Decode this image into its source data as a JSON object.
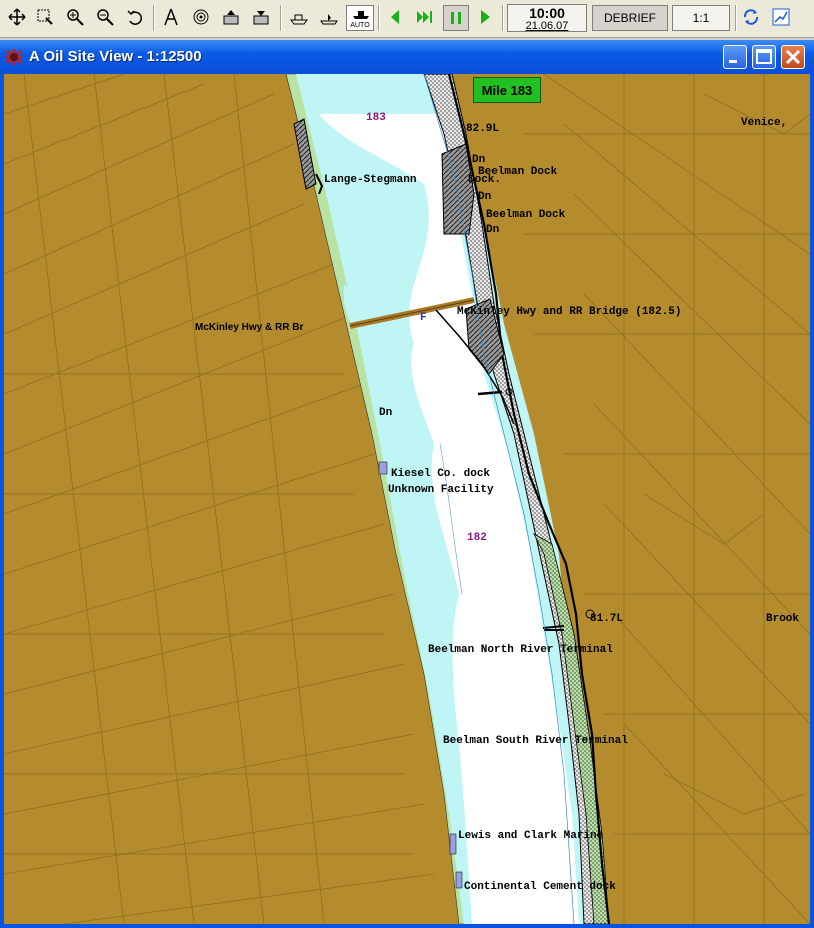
{
  "toolbar": {
    "auto_label": "AUTO",
    "time": "10:00",
    "date": "21.06.07",
    "debrief_label": "DEBRIEF",
    "scale_ratio": "1:1",
    "icons": [
      "pan-icon",
      "select-icon",
      "zoom-in-icon",
      "zoom-out-icon",
      "undo-icon",
      "compass-icon",
      "target-icon",
      "upload-icon",
      "download-icon",
      "boat-icon",
      "ship-icon",
      "auto-ship-icon",
      "step-back-icon",
      "fast-forward-icon",
      "pause-icon",
      "play-icon",
      "sync-icon",
      "chart-icon"
    ]
  },
  "window": {
    "title": "A Oil Site View - 1:12500",
    "title_color": "#0a5ae6"
  },
  "map": {
    "mile_marker": "Mile 183",
    "land_color": "#b48c2e",
    "water_color": "#bff5f5",
    "channel_color": "#ffffff",
    "bank_color": "#b9e3a4",
    "labels": {
      "venice": "Venice,",
      "brook": "Brook",
      "m183": "183",
      "m182": "182",
      "m1829": "82.9L",
      "m1817": "81.7L",
      "dn1": "Dn",
      "dn2": "Dn",
      "dn3": "Dn",
      "dn4": "Dn",
      "beelman1": "Beelman Dock",
      "dock": "Dock.",
      "beelman2": "Beelman Dock",
      "lange": "Lange-Stegmann",
      "mckinley_left": "McKinley Hwy & RR Br",
      "mckinley_bridge": "McKinley Hwy and RR Bridge (182.5)",
      "kiesel": "Kiesel Co. dock",
      "unknown": "Unknown Facility",
      "beelman_north": "Beelman North River Terminal",
      "beelman_south": "Beelman South River Terminal",
      "lewis": "Lewis and Clark Marine",
      "continental": "Continental Cement dock",
      "flag": "F"
    }
  }
}
